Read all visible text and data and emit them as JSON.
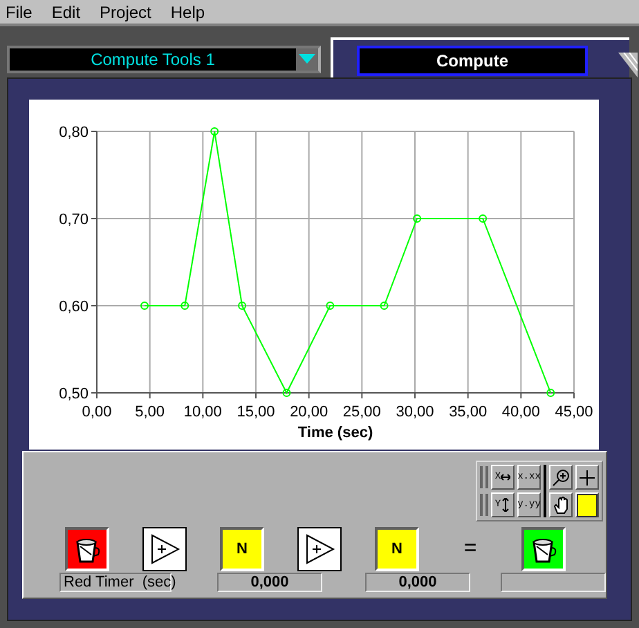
{
  "menu": [
    {
      "label": "File"
    },
    {
      "label": "Edit"
    },
    {
      "label": "Project"
    },
    {
      "label": "Help"
    }
  ],
  "tool_selector": {
    "value": "Compute Tools 1"
  },
  "tab": {
    "label": "Compute",
    "selected": true
  },
  "chart": {
    "chart_data": {
      "type": "line",
      "grid": true,
      "xlabel": "Time (sec)",
      "x": [
        4.5,
        8.3,
        11.1,
        13.7,
        17.9,
        22.0,
        27.1,
        30.2,
        36.4,
        42.8
      ],
      "series": [
        {
          "color": "#00ff00",
          "marker": "circle",
          "values": [
            0.6,
            0.6,
            0.8,
            0.6,
            0.5,
            0.6,
            0.6,
            0.7,
            0.7,
            0.5
          ]
        }
      ],
      "xlim": [
        0,
        45
      ],
      "ylim": [
        0.5,
        0.8
      ],
      "xticks": [
        {
          "value": 0,
          "label": "0,00"
        },
        {
          "value": 5,
          "label": "5,00"
        },
        {
          "value": 10,
          "label": "10,00"
        },
        {
          "value": 15,
          "label": "15,00"
        },
        {
          "value": 20,
          "label": "20,00"
        },
        {
          "value": 25,
          "label": "25,00"
        },
        {
          "value": 30,
          "label": "30,00"
        },
        {
          "value": 35,
          "label": "35,00"
        },
        {
          "value": 40,
          "label": "40,00"
        },
        {
          "value": 45,
          "label": "45,00"
        }
      ],
      "yticks": [
        {
          "value": 0.5,
          "label": "0,50"
        },
        {
          "value": 0.6,
          "label": "0,60"
        },
        {
          "value": 0.7,
          "label": "0,70"
        },
        {
          "value": 0.8,
          "label": "0,80"
        }
      ]
    }
  },
  "graph_tools": [
    {
      "kind": "x-scale",
      "label": "X"
    },
    {
      "kind": "x-format",
      "label": "x.xx"
    },
    {
      "kind": "zoom"
    },
    {
      "kind": "cursor"
    },
    {
      "kind": "y-scale",
      "label": "Y"
    },
    {
      "kind": "y-format",
      "label": "y.yy"
    },
    {
      "kind": "pan"
    },
    {
      "kind": "color",
      "color": "#ffff00"
    }
  ],
  "diagram": {
    "nodes": [
      {
        "kind": "bucket",
        "color": "#ff0000"
      },
      {
        "kind": "amplifier"
      },
      {
        "kind": "number",
        "label": "N"
      },
      {
        "kind": "amplifier"
      },
      {
        "kind": "number",
        "label": "N"
      },
      {
        "kind": "equals",
        "label": "="
      },
      {
        "kind": "bucket",
        "color": "#00ff00"
      }
    ],
    "readouts": [
      {
        "kind": "label",
        "text": "Red Timer  (sec)"
      },
      {
        "kind": "value",
        "text": "0,000"
      },
      {
        "kind": "value",
        "text": "0,000"
      },
      {
        "kind": "value"
      }
    ]
  }
}
